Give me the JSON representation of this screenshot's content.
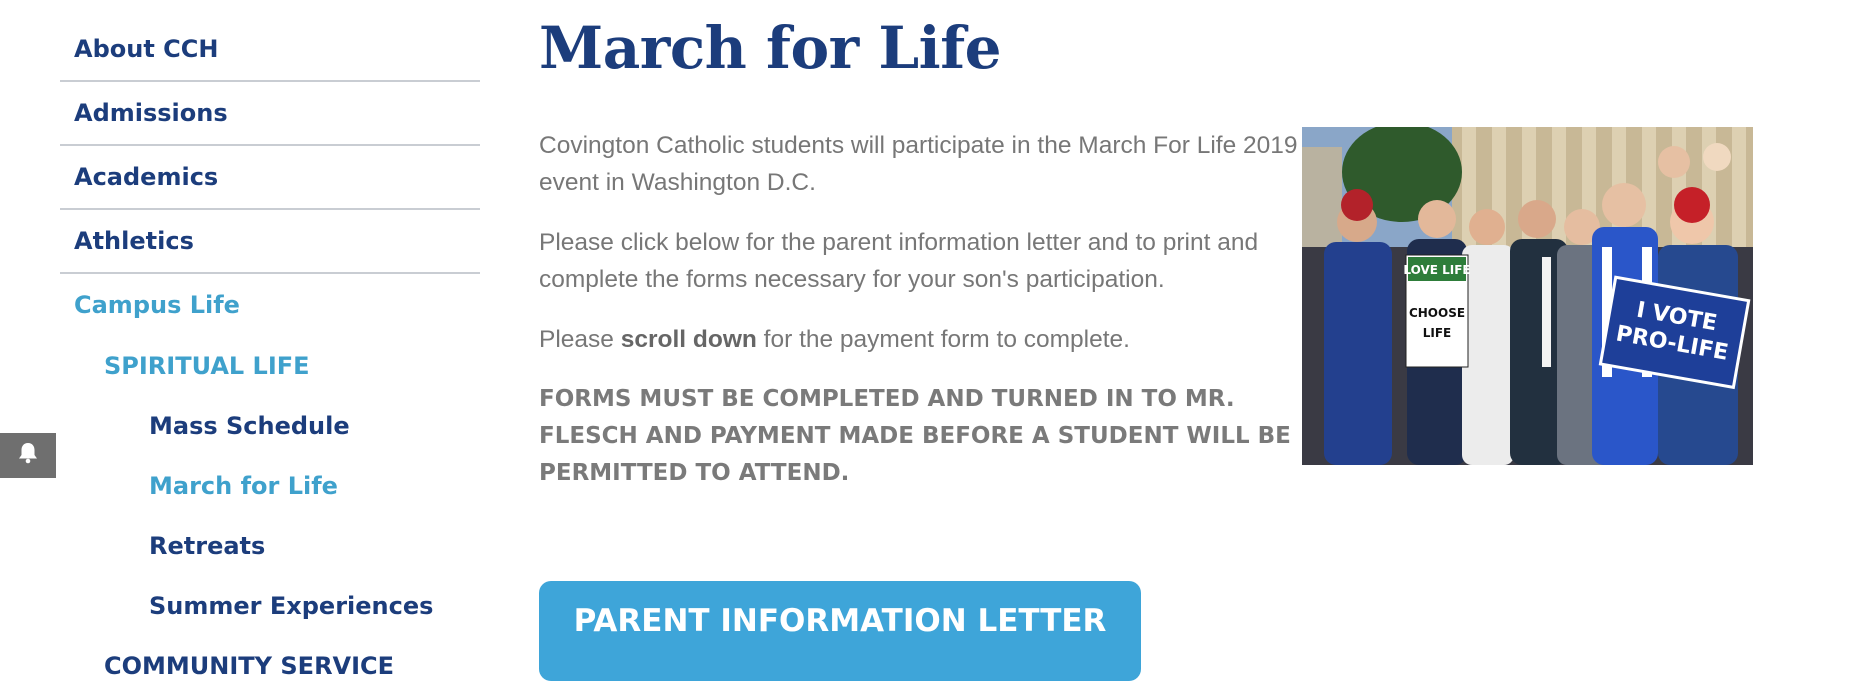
{
  "sidebar": {
    "items": [
      {
        "label": "About CCH"
      },
      {
        "label": "Admissions"
      },
      {
        "label": "Academics"
      },
      {
        "label": "Athletics"
      },
      {
        "label": "Campus Life"
      }
    ],
    "submenu": {
      "spiritual_life": "SPIRITUAL LIFE",
      "children": [
        {
          "label": "Mass Schedule"
        },
        {
          "label": "March for Life"
        },
        {
          "label": "Retreats"
        },
        {
          "label": "Summer Experiences"
        }
      ],
      "community_service": "COMMUNITY SERVICE"
    }
  },
  "page": {
    "title": "March for Life",
    "intro": "Covington Catholic students will participate in the March For Life 2019 event in Washington D.C.",
    "instructions": "Please click below for the parent information letter and to print and complete the forms necessary for your son's participation.",
    "scroll_prefix": "Please ",
    "scroll_bold": "scroll down",
    "scroll_suffix": " for the payment form to complete.",
    "warning": "FORMS MUST BE COMPLETED AND TURNED IN TO MR. FLESCH AND PAYMENT MADE BEFORE A STUDENT WILL BE PERMITTED TO ATTEND.",
    "cta_label": "PARENT INFORMATION LETTER"
  },
  "photo": {
    "sign1_line1": "LOVE LIFE",
    "sign1_line2": "CHOOSE",
    "sign1_line3": "LIFE",
    "sign2_line1": "I VOTE",
    "sign2_line2": "PRO-LIFE"
  },
  "colors": {
    "navy": "#1c3d7c",
    "active_blue": "#3fa1cc",
    "button_blue": "#3ea5d9",
    "body_text": "#777777"
  },
  "icons": {
    "notification": "bell-icon"
  }
}
